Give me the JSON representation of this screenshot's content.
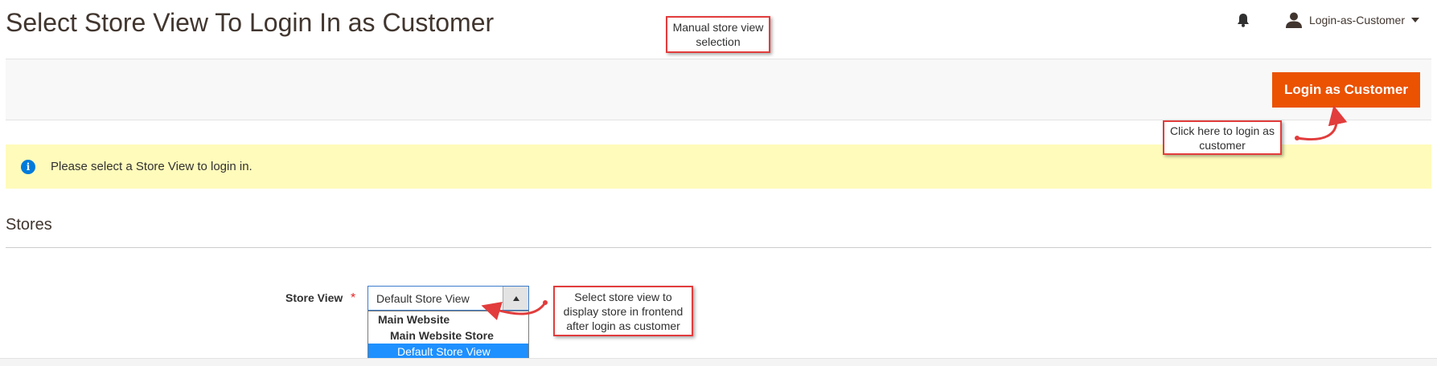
{
  "header": {
    "title": "Select Store View To Login In as Customer",
    "user_name": "Login-as-Customer"
  },
  "actions": {
    "primary_label": "Login as Customer"
  },
  "message": {
    "text": "Please select a Store View to login in."
  },
  "section": {
    "title": "Stores"
  },
  "form": {
    "store_view_label": "Store View",
    "required_mark": "*",
    "selected_value": "Default Store View",
    "options": {
      "group": "Main Website",
      "subgroup": "Main Website Store",
      "option": "Default Store View"
    }
  },
  "annotations": {
    "manual_selection": "Manual store view selection",
    "click_login": "Click here to login as customer",
    "select_store": "Select store view to display store in frontend after login as customer"
  },
  "colors": {
    "primary_button": "#eb5202",
    "message_bg": "#fffbbb",
    "info_icon": "#007bdb",
    "callout_border": "#e23c3c",
    "selected_option": "#1e90ff"
  },
  "icons": {
    "notifications": "bell-icon",
    "user": "user-icon",
    "info": "info-icon",
    "dropdown": "triangle-up-icon"
  }
}
